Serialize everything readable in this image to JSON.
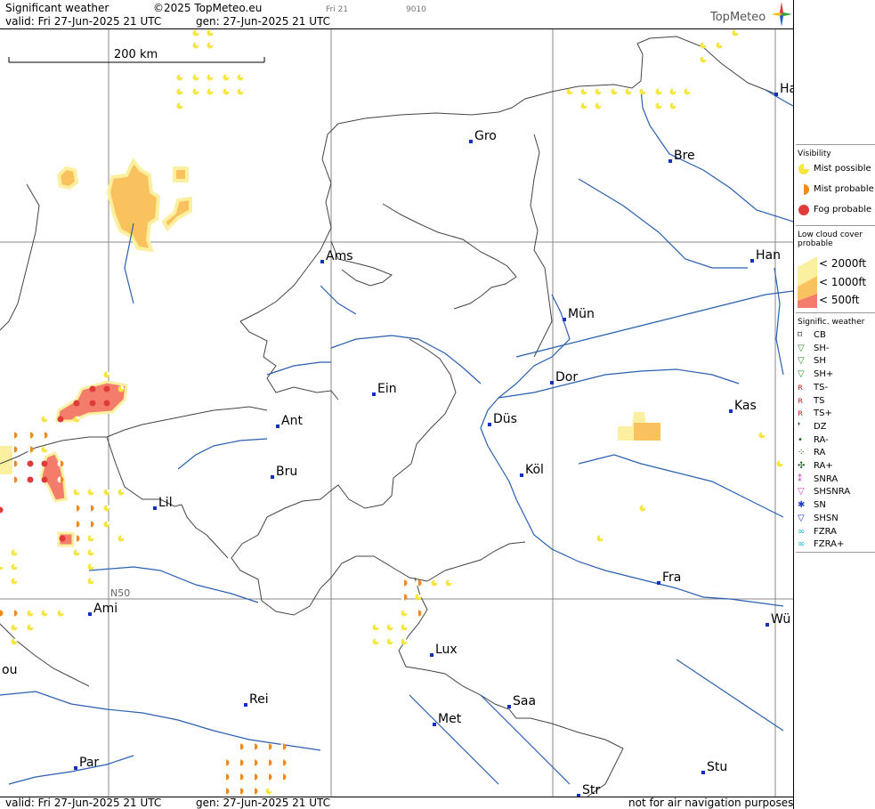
{
  "header": {
    "product": "Significant weather",
    "copyright": "©2025 TopMeteo.eu",
    "run_small": "Fri 21",
    "code_small": "9010",
    "valid": "valid:  Fri   27-Jun-2025   21 UTC",
    "gen": "gen: 27-Jun-2025  21 UTC",
    "brand": "TopMeteo"
  },
  "map": {
    "scale_label": "200 km",
    "lat_label": "N50",
    "cities": [
      {
        "name": "Gro"
      },
      {
        "name": "Bre"
      },
      {
        "name": "Ha"
      },
      {
        "name": "Ams"
      },
      {
        "name": "Han"
      },
      {
        "name": "Mün"
      },
      {
        "name": "Dor"
      },
      {
        "name": "Ein"
      },
      {
        "name": "Ant"
      },
      {
        "name": "Düs"
      },
      {
        "name": "Kas"
      },
      {
        "name": "Bru"
      },
      {
        "name": "Köl"
      },
      {
        "name": "Lil"
      },
      {
        "name": "Fra"
      },
      {
        "name": "Ami"
      },
      {
        "name": "Wü"
      },
      {
        "name": "Lux"
      },
      {
        "name": "Rei"
      },
      {
        "name": "Saa"
      },
      {
        "name": "Met"
      },
      {
        "name": "Par"
      },
      {
        "name": "Stu"
      },
      {
        "name": "Str"
      },
      {
        "name": "ou"
      }
    ]
  },
  "legend": {
    "visibility_title": "Visibility",
    "visibility": [
      "Mist possible",
      "Mist probable",
      "Fog probable"
    ],
    "lowcloud_title": "Low cloud cover probable",
    "lowcloud": [
      "< 2000ft",
      "< 1000ft",
      "<   500ft"
    ],
    "sigwx_title": "Signific. weather",
    "sigwx": [
      "CB",
      "SH-",
      "SH",
      "SH+",
      "TS-",
      "TS",
      "TS+",
      "DZ",
      "RA-",
      "RA",
      "RA+",
      "SNRA",
      "SHSNRA",
      "SN",
      "SHSN",
      "FZRA",
      "FZRA+"
    ],
    "colors": {
      "mist_possible": "#f5e642",
      "mist_probable": "#f08a1c",
      "fog": "#e03a3a",
      "lc2000": "#fbf0a0",
      "lc1000": "#f9c25e",
      "lc500": "#f47c6a"
    }
  },
  "footer": {
    "valid": "valid:  Fri   27-Jun-2025   21 UTC",
    "gen": "gen: 27-Jun-2025  21 UTC",
    "disclaimer": "not for air navigation purposes"
  }
}
